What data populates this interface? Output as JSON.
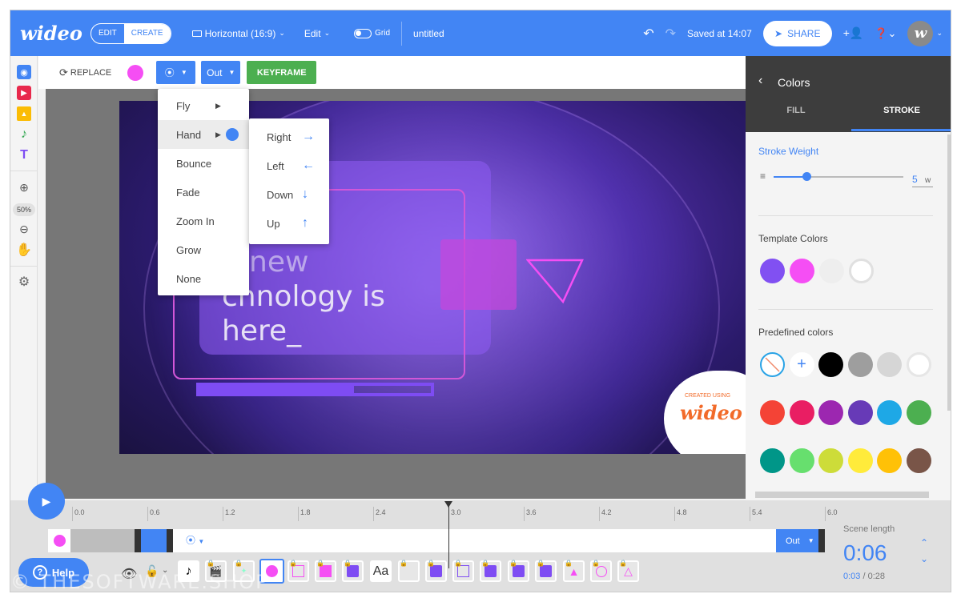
{
  "topbar": {
    "logo": "wideo",
    "mode_edit": "EDIT",
    "mode_create": "CREATE",
    "format": "Horizontal (16:9)",
    "edit_menu": "Edit",
    "grid_label": "Grid",
    "title": "untitled",
    "saved": "Saved at 14:07",
    "share": "SHARE",
    "avatar_letter": "w"
  },
  "leftbar": {
    "zoom_level": "50%"
  },
  "toolbar": {
    "replace": "REPLACE",
    "out_label": "Out",
    "keyframe": "KEYFRAME",
    "selected_color": "#f54ef4"
  },
  "animation_menu": {
    "items": [
      "Fly",
      "Hand",
      "Bounce",
      "Fade",
      "Zoom In",
      "Grow",
      "None"
    ],
    "highlighted": "Hand",
    "submenu": [
      {
        "label": "Right",
        "icon": "arrow-right-icon",
        "glyph": "→"
      },
      {
        "label": "Left",
        "icon": "arrow-left-icon",
        "glyph": "←"
      },
      {
        "label": "Down",
        "icon": "arrow-down-icon",
        "glyph": "↓"
      },
      {
        "label": "Up",
        "icon": "arrow-up-icon",
        "glyph": "↑"
      }
    ]
  },
  "canvas": {
    "headline_line1": "new",
    "headline_line2": "chnology is",
    "headline_line3": "here_",
    "badge_small": "CREATED USING",
    "badge_logo": "wideo"
  },
  "colors_panel": {
    "title": "Colors",
    "tab_fill": "FILL",
    "tab_stroke": "STROKE",
    "active_tab": "STROKE",
    "stroke_weight_label": "Stroke Weight",
    "stroke_weight_value": "5",
    "stroke_weight_unit": "w",
    "slider_fraction": 0.25,
    "template_colors_label": "Template Colors",
    "template_colors": [
      "#8150f2",
      "#f54ef4",
      "#eeeeee",
      "#ffffff"
    ],
    "predefined_label": "Predefined colors",
    "predefined_colors": [
      [
        "none",
        "add",
        "#000000",
        "#9e9e9e",
        "#d6d6d6",
        "#ffffff"
      ],
      [
        "#f44336",
        "#e91e63",
        "#9c27b0",
        "#673ab7",
        "#1ea8e6",
        "#4caf50"
      ],
      [
        "#009688",
        "#67df6e",
        "#cddc39",
        "#ffeb3b",
        "#ffc107",
        "#795548"
      ]
    ]
  },
  "timeline": {
    "ticks": [
      "0.0",
      "0.6",
      "1.2",
      "1.8",
      "2.4",
      "3.0",
      "3.6",
      "4.2",
      "4.8",
      "5.4",
      "6.0"
    ],
    "out_label": "Out",
    "scene_length_label": "Scene length",
    "scene_length": "0:06",
    "current_time": "0:03",
    "total_time": "0:28",
    "help": "Help",
    "text_thumb": "Aa"
  },
  "watermark": "© THESOFTWARE.SHOP"
}
